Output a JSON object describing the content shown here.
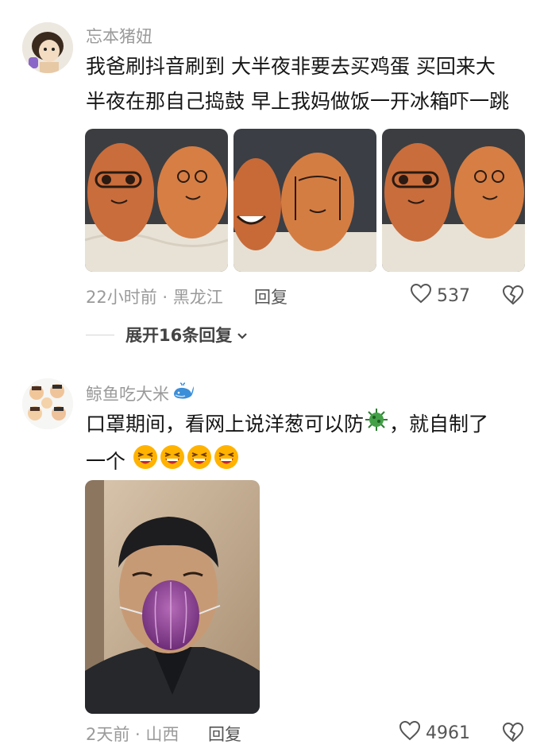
{
  "comments": [
    {
      "username": "忘本猪妞",
      "text_line1": "我爸刷抖音刷到 大半夜非要去买鸡蛋 买回来大",
      "text_line2": "半夜在那自己捣鼓 早上我妈做饭一开冰箱吓一跳",
      "time_location": "22小时前 · 黑龙江",
      "reply_label": "回复",
      "likes": "537",
      "expand_label": "展开16条回复"
    },
    {
      "username": "鲸鱼吃大米",
      "text_part1": "口罩期间，看网上说洋葱可以防",
      "text_part2": "，就自制了",
      "text_line2": "一个",
      "time_location": "2天前 · 山西",
      "reply_label": "回复",
      "likes": "4961"
    }
  ],
  "colors": {
    "meta": "#9a9a9a",
    "text": "#161616",
    "egg": "#d9824a"
  },
  "icons": [
    "heart-outline-icon",
    "broken-heart-icon",
    "chevron-down-icon",
    "whale-icon",
    "virus-emoji-icon",
    "laughing-emoji-icon"
  ]
}
